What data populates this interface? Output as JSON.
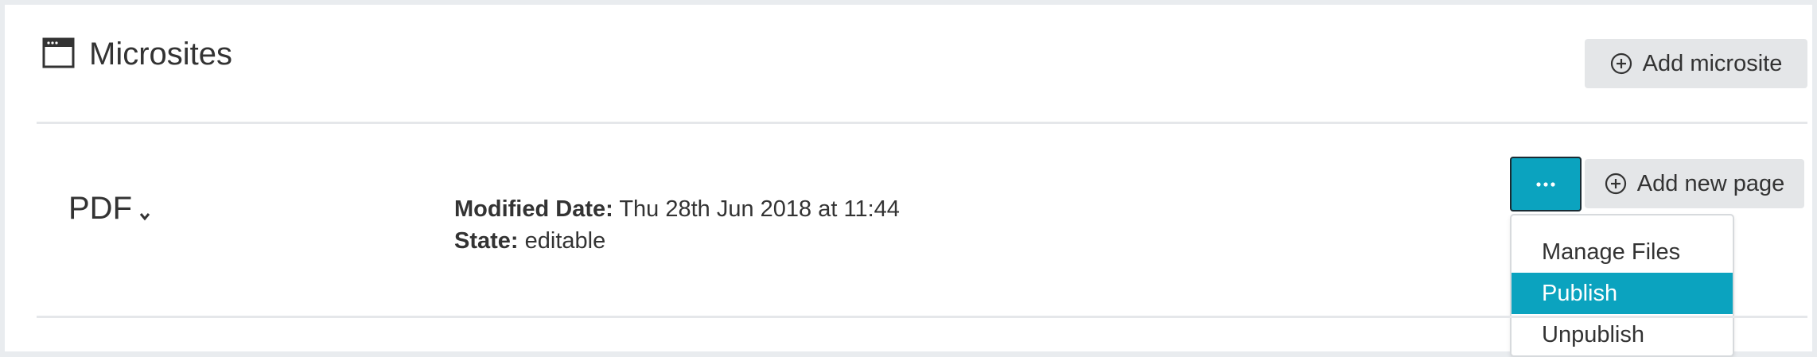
{
  "header": {
    "icon": "browser-window-icon",
    "title": "Microsites",
    "add_microsite_label": "Add microsite",
    "add_icon": "plus-circle-icon"
  },
  "microsite": {
    "name": "PDF",
    "name_icon": "chevron-down-icon",
    "modified_label": "Modified Date:",
    "modified_value": "Thu 28th Jun 2018 at 11:44",
    "state_label": "State:",
    "state_value": "editable",
    "more_icon": "ellipsis-icon",
    "add_page_label": "Add new page"
  },
  "menu": {
    "items": [
      {
        "label": "Manage Files",
        "active": false
      },
      {
        "label": "Publish",
        "active": true
      },
      {
        "label": "Unpublish",
        "active": false
      }
    ]
  },
  "colors": {
    "accent": "#0ba3bf",
    "button_bg": "#e4e6e8",
    "page_bg": "#e9ecef"
  }
}
